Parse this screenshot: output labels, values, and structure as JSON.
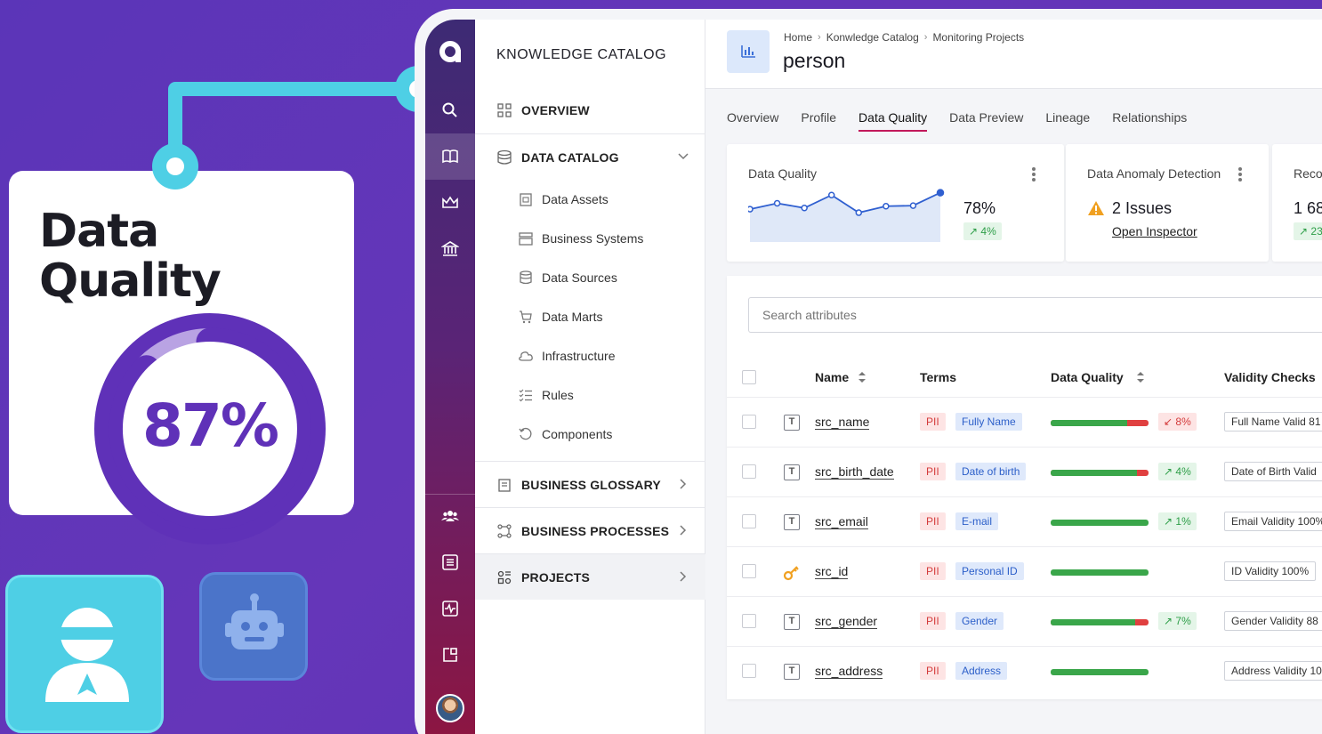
{
  "promo": {
    "title_line1": "Data",
    "title_line2": "Quality",
    "gauge_value": "87%",
    "gauge_fraction": 0.87,
    "accent": "#5f31b8",
    "connector_color": "#4ecfe5"
  },
  "rail": {
    "logo": "ataccama-logo",
    "items": [
      "search-icon",
      "book-icon",
      "crown-icon",
      "bank-icon",
      "people-icon",
      "list-icon",
      "monitor-icon",
      "export-icon"
    ],
    "active": "book-icon"
  },
  "nav": {
    "heading": "KNOWLEDGE CATALOG",
    "overview": "OVERVIEW",
    "data_catalog": "DATA CATALOG",
    "sub_items": [
      "Data Assets",
      "Business Systems",
      "Data Sources",
      "Data Marts",
      "Infrastructure",
      "Rules",
      "Components"
    ],
    "business_glossary": "BUSINESS GLOSSARY",
    "business_processes": "BUSINESS PROCESSES",
    "projects": "PROJECTS"
  },
  "header": {
    "breadcrumb": [
      "Home",
      "Konwledge Catalog",
      "Monitoring Projects"
    ],
    "title": "person"
  },
  "tabs": [
    {
      "label": "Overview",
      "active": false
    },
    {
      "label": "Profile",
      "active": false
    },
    {
      "label": "Data Quality",
      "active": true
    },
    {
      "label": "Data Preview",
      "active": false
    },
    {
      "label": "Lineage",
      "active": false
    },
    {
      "label": "Relationships",
      "active": false
    }
  ],
  "cards": {
    "data_quality": {
      "title": "Data Quality",
      "value": "78%",
      "trend": "4%",
      "sparkline": [
        62,
        72,
        64,
        86,
        56,
        67,
        68,
        90
      ]
    },
    "anomaly": {
      "title": "Data Anomaly Detection",
      "issues": "2 Issues",
      "link": "Open Inspector"
    },
    "third": {
      "title": "Reco",
      "value": "1 68",
      "trend": "23"
    }
  },
  "table": {
    "search_placeholder": "Search attributes",
    "columns": {
      "name": "Name",
      "terms": "Terms",
      "data_quality": "Data Quality",
      "validity": "Validity Checks"
    },
    "rows": [
      {
        "type": "text",
        "name": "src_name",
        "pii": "PII",
        "term": "Fully Name",
        "dq": 0.78,
        "delta": "8%",
        "dir": "down",
        "validity": "Full Name Valid 81"
      },
      {
        "type": "text",
        "name": "src_birth_date",
        "pii": "PII",
        "term": "Date of birth",
        "dq": 0.88,
        "delta": "4%",
        "dir": "up",
        "validity": "Date of Birth Valid"
      },
      {
        "type": "text",
        "name": "src_email",
        "pii": "PII",
        "term": "E-mail",
        "dq": 1.0,
        "delta": "1%",
        "dir": "up",
        "validity": "Email Validity 100%"
      },
      {
        "type": "key",
        "name": "src_id",
        "pii": "PII",
        "term": "Personal ID",
        "dq": 1.0,
        "delta": "",
        "dir": "",
        "validity": "ID Validity 100%"
      },
      {
        "type": "text",
        "name": "src_gender",
        "pii": "PII",
        "term": "Gender",
        "dq": 0.86,
        "delta": "7%",
        "dir": "up",
        "validity": "Gender Validity 88"
      },
      {
        "type": "text",
        "name": "src_address",
        "pii": "PII",
        "term": "Address",
        "dq": 1.0,
        "delta": "",
        "dir": "",
        "validity": "Address Validity 10"
      }
    ]
  }
}
